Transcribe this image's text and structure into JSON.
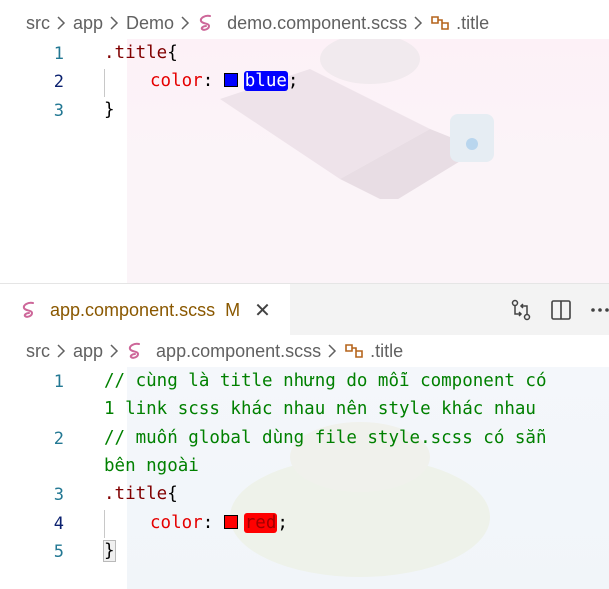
{
  "top_pane": {
    "breadcrumb": {
      "seg1": "src",
      "seg2": "app",
      "seg3": "Demo",
      "file": "demo.component.scss",
      "symbol": ".title"
    },
    "line_numbers": [
      "1",
      "2",
      "3"
    ],
    "code": {
      "selector": ".title",
      "open_brace": "{",
      "property": "color",
      "colon": ": ",
      "value": "blue",
      "semicolon": ";",
      "close_brace": "}"
    },
    "value_color": "#0000ff"
  },
  "tab": {
    "filename": "app.component.scss",
    "modified": "M",
    "close": "✕"
  },
  "bottom_pane": {
    "breadcrumb": {
      "seg1": "src",
      "seg2": "app",
      "file": "app.component.scss",
      "symbol": ".title"
    },
    "line_numbers": [
      "1",
      "2",
      "3",
      "4",
      "5"
    ],
    "code": {
      "comment1a": "// cùng là title nhưng do mỗi component có",
      "comment1b": "1 link scss khác nhau nên style khác nhau",
      "comment2a": "// muốn global dùng file style.scss có sẵn",
      "comment2b": "bên ngoài",
      "selector": ".title",
      "open_brace": "{",
      "property": "color",
      "colon": ": ",
      "value": "red",
      "semicolon": ";",
      "close_brace": "}"
    },
    "value_color": "#ff0000"
  },
  "icons": {
    "sass": "sass-file-icon",
    "symbol": "symbol-class-icon",
    "compare": "compare-changes-icon",
    "split": "split-editor-icon",
    "more": "more-actions-icon"
  },
  "colors": {
    "selector": "#800000",
    "property": "#e50000",
    "comment": "#008000",
    "line_number": "#237893",
    "active_line_number": "#0b216f",
    "sass_pink": "#cd6799",
    "symbol_orange": "#b5651d"
  }
}
